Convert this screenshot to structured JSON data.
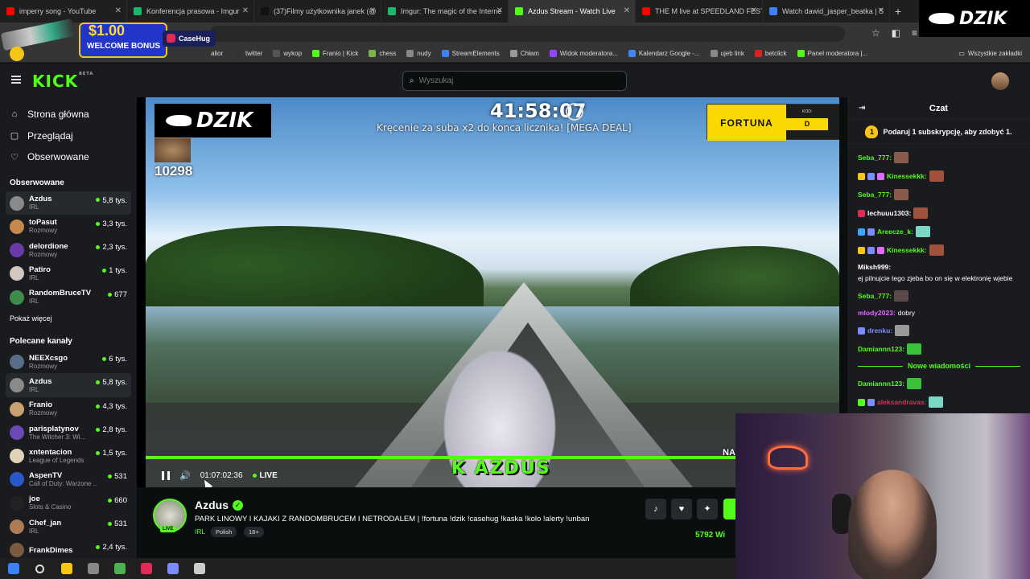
{
  "browser": {
    "tabs": [
      {
        "label": "imperry song - YouTube",
        "color": "#ff0000"
      },
      {
        "label": "Konferencja prasowa - Imgur",
        "color": "#1bb76e"
      },
      {
        "label": "(37)Filmy użytkownika janek (@",
        "color": "#111111"
      },
      {
        "label": "Imgur: The magic of the Interne",
        "color": "#1bb76e"
      },
      {
        "label": "Azdus Stream - Watch Live",
        "color": "#53fc18",
        "active": true
      },
      {
        "label": "THE M live at SPEEDLAND FEST",
        "color": "#ff0000"
      },
      {
        "label": "Watch dawid_jasper_beatka | S",
        "color": "#3b82f6"
      }
    ],
    "new_tab": "+",
    "bookmarks": [
      {
        "label": "twitter",
        "color": "#333333"
      },
      {
        "label": "wykop",
        "color": "#555555"
      },
      {
        "label": "Franio | Kick",
        "color": "#53fc18"
      },
      {
        "label": "chess",
        "color": "#7ab648"
      },
      {
        "label": "nudy",
        "color": "#888888"
      },
      {
        "label": "StreamElements",
        "color": "#3b82f6"
      },
      {
        "label": "Chłam",
        "color": "#999999"
      },
      {
        "label": "Widok moderatora...",
        "color": "#9147ff"
      },
      {
        "label": "Kalendarz Google -...",
        "color": "#4285f4"
      },
      {
        "label": "ujeb link",
        "color": "#888888"
      },
      {
        "label": "betclick",
        "color": "#e02020"
      },
      {
        "label": "Panel moderatora |...",
        "color": "#53fc18"
      }
    ],
    "bookmark_first": "alior",
    "all_bookmarks": "Wszystkie zakładki"
  },
  "overlay": {
    "casino_amount": "$1.00",
    "casino_bonus": "WELCOME BONUS",
    "casino_brand": "CaseHug",
    "dzik_brand": "DZIK"
  },
  "header": {
    "logo": "KICK",
    "logo_sup": "BETA",
    "search_placeholder": "Wyszukaj"
  },
  "sidebar": {
    "nav": [
      {
        "label": "Strona główna",
        "icon": "⌂"
      },
      {
        "label": "Przeglądaj",
        "icon": "▢"
      },
      {
        "label": "Obserwowane",
        "icon": "♡"
      }
    ],
    "followed_title": "Obserwowane",
    "followed": [
      {
        "name": "Azdus",
        "category": "IRL",
        "viewers": "5,8 tys.",
        "color": "#8a8a8a",
        "selected": true
      },
      {
        "name": "toPasut",
        "category": "Rozmowy",
        "viewers": "3,3 tys.",
        "color": "#c8884d"
      },
      {
        "name": "delordione",
        "category": "Rozmowy",
        "viewers": "2,3 tys.",
        "color": "#6b3aa8"
      },
      {
        "name": "Patiro",
        "category": "IRL",
        "viewers": "1 tys.",
        "color": "#d1c7c0"
      },
      {
        "name": "RandomBruceTV",
        "category": "IRL",
        "viewers": "677",
        "color": "#3f8c4a"
      }
    ],
    "show_more": "Pokaż więcej",
    "recommended_title": "Polecane kanały",
    "recommended": [
      {
        "name": "NEEXcsgo",
        "category": "Rozmowy",
        "viewers": "6 tys.",
        "color": "#5a6d88"
      },
      {
        "name": "Azdus",
        "category": "IRL",
        "viewers": "5,8 tys.",
        "color": "#8a8a8a",
        "selected": true
      },
      {
        "name": "Franio",
        "category": "Rozmowy",
        "viewers": "4,3 tys.",
        "color": "#c9a06f"
      },
      {
        "name": "parisplatynov",
        "category": "The Witcher 3: Wi...",
        "viewers": "2,8 tys.",
        "color": "#6b4ab8"
      },
      {
        "name": "xntentacion",
        "category": "League of Legends",
        "viewers": "1,5 tys.",
        "color": "#e0d2b8"
      },
      {
        "name": "AspenTV",
        "category": "Call of Duty: Warzone ...",
        "viewers": "531",
        "color": "#2a58c9"
      },
      {
        "name": "joe",
        "category": "Slots & Casino",
        "viewers": "660",
        "color": "#222222"
      },
      {
        "name": "Chef_jan",
        "category": "IRL",
        "viewers": "531",
        "color": "#b07a55"
      },
      {
        "name": "FrankDimes",
        "category": "",
        "viewers": "2,4 tys.",
        "color": "#7a5a40"
      }
    ]
  },
  "video": {
    "sub_count": "10298",
    "timer": "41:58:07",
    "promo_text": "Kręcenie za suba x2 do konca licznika! [MEGA DEAL]",
    "fortuna_label": "FORTUNA",
    "fortuna_kod": "KOD:",
    "fortuna_code": "D",
    "banner": "K AZDUS",
    "corner_text": "NA N",
    "elapsed": "01:07:02:36",
    "live_label": "LIVE",
    "progress": 1.0
  },
  "stream": {
    "name": "Azdus",
    "live_tag": "LIVE",
    "title": "PARK LINOWY I KAJAKI Z RANDOMBRUCEM I NETRODALEM | !fortuna !dzik !casehug !kaska !kolo !alerty !unban",
    "category": "IRL",
    "tags": [
      "Polish",
      "18+"
    ],
    "viewers": "5792 Wi",
    "verified_icon": "✓"
  },
  "chat": {
    "title": "Czat",
    "goal_count": "1",
    "goal_text": "Podaruj 1 subskrypcję, aby zdobyć 1.",
    "messages": [
      {
        "user": "Seba_777:",
        "color": "#53fc18",
        "text": "",
        "emote": "#8a5a4a",
        "badges": []
      },
      {
        "user": "Kinessekkk:",
        "color": "#53fc18",
        "text": "",
        "emote": "#a0523e",
        "badges": [
          "#f5c518",
          "#7b8cff",
          "#e06bff"
        ]
      },
      {
        "user": "Seba_777:",
        "color": "#53fc18",
        "text": "",
        "emote": "#8a5a4a",
        "badges": []
      },
      {
        "user": "lechuuu1303:",
        "color": "#ffffff",
        "text": "",
        "emote": "#a0523e",
        "badges": [
          "#e02b56"
        ]
      },
      {
        "user": "Areecze_k:",
        "color": "#53fc18",
        "text": "",
        "emote": "#7ad6c6",
        "badges": [
          "#3aa6ff",
          "#7b8cff"
        ]
      },
      {
        "user": "Kinessekkk:",
        "color": "#53fc18",
        "text": "",
        "emote": "#a0523e",
        "badges": [
          "#f5c518",
          "#7b8cff",
          "#e06bff"
        ]
      },
      {
        "user": "Miksh999:",
        "color": "#ffffff",
        "text": "ej pilnujcie tego zjeba bo on się w elektronię wjebie",
        "emote": "",
        "badges": []
      },
      {
        "user": "Seba_777:",
        "color": "#53fc18",
        "text": "",
        "emote": "#5a4a4a",
        "badges": []
      },
      {
        "user": "mlody2023:",
        "color": "#e06bff",
        "text": "dobry",
        "emote": "",
        "badges": []
      },
      {
        "user": "drenku:",
        "color": "#7b8cff",
        "text": "",
        "emote": "#999999",
        "badges": [
          "#7b8cff"
        ]
      },
      {
        "user": "Damiannn123:",
        "color": "#53fc18",
        "text": "",
        "emote": "#3ac13a",
        "badges": []
      }
    ],
    "new_messages": "Nowe wiadomości",
    "after": [
      {
        "user": "Damiannn123:",
        "color": "#53fc18",
        "text": "",
        "emote": "#3ac13a",
        "badges": []
      },
      {
        "user": "aleksandravas:",
        "color": "#e02b56",
        "text": "",
        "emote": "#7ad6c6",
        "badges": [
          "#53fc18",
          "#7b8cff"
        ]
      }
    ]
  },
  "taskbar": [
    {
      "name": "windows-start",
      "color": "#3b82f6"
    },
    {
      "name": "search",
      "color": "#dddddd"
    },
    {
      "name": "file-explorer",
      "color": "#f5c518"
    },
    {
      "name": "app-1",
      "color": "#888888"
    },
    {
      "name": "chrome",
      "color": "#4caf50"
    },
    {
      "name": "app-2",
      "color": "#e02b56"
    },
    {
      "name": "app-3",
      "color": "#7b8cff"
    },
    {
      "name": "settings",
      "color": "#cccccc"
    }
  ]
}
